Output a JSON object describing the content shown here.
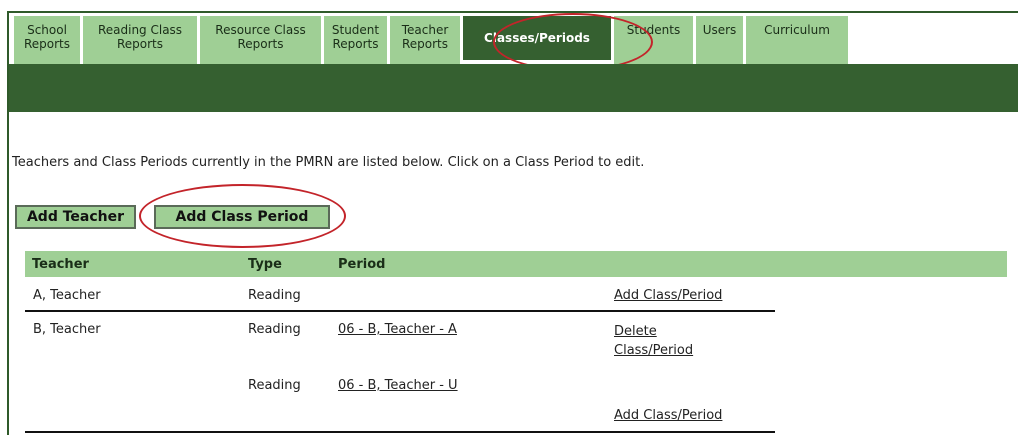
{
  "tabs": [
    {
      "line1": "School",
      "line2": "Reports"
    },
    {
      "line1": "Reading Class",
      "line2": "Reports"
    },
    {
      "line1": "Resource Class",
      "line2": "Reports"
    },
    {
      "line1": "Student",
      "line2": "Reports"
    },
    {
      "line1": "Teacher",
      "line2": "Reports"
    },
    {
      "line1": "Classes/Periods",
      "line2": ""
    },
    {
      "line1": "Students",
      "line2": ""
    },
    {
      "line1": "Users",
      "line2": ""
    },
    {
      "line1": "Curriculum",
      "line2": ""
    }
  ],
  "intro_text": "Teachers and Class Periods currently in the PMRN are listed below. Click on a Class Period to edit.",
  "buttons": {
    "add_teacher": "Add Teacher",
    "add_class_period": "Add Class Period"
  },
  "table": {
    "headers": {
      "teacher": "Teacher",
      "type": "Type",
      "period": "Period"
    },
    "rows": [
      {
        "teacher": "A, Teacher",
        "type": "Reading",
        "period": "",
        "action": "Add Class/Period"
      },
      {
        "teacher": "B, Teacher",
        "type": "Reading",
        "period": "06 - B, Teacher - A",
        "action_line1": "Delete",
        "action_line2": "Class/Period"
      },
      {
        "teacher": "",
        "type": "Reading",
        "period": "06 - B, Teacher - U",
        "action": ""
      },
      {
        "teacher": "",
        "type": "",
        "period": "",
        "action": "Add Class/Period"
      }
    ]
  },
  "colors": {
    "dark_green": "#356030",
    "light_green": "#9fcf95",
    "highlight_oval": "#c3242a"
  }
}
